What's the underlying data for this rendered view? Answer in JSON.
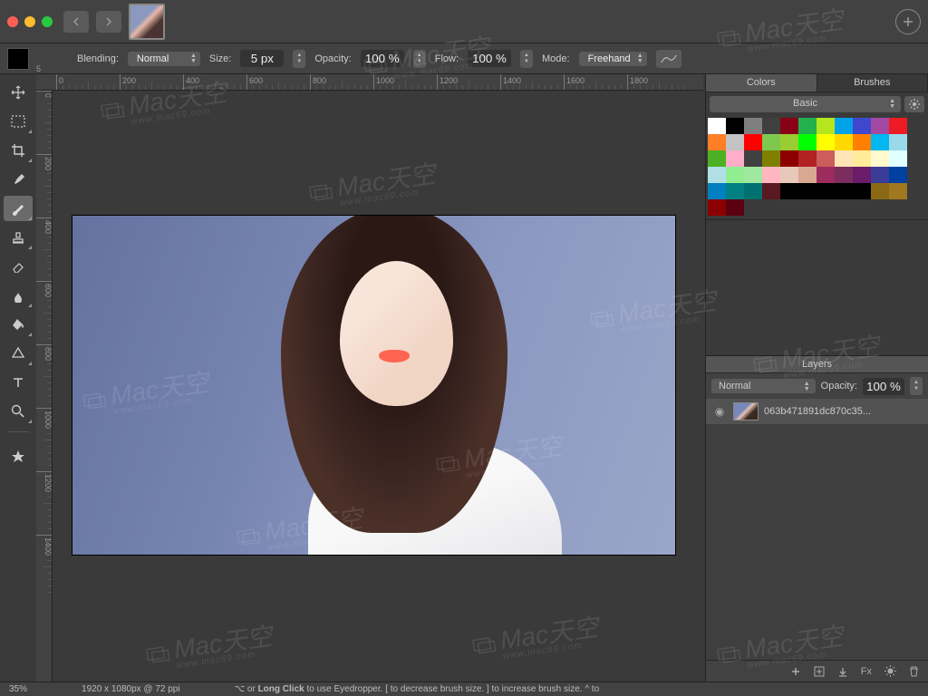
{
  "options": {
    "blending_label": "Blending:",
    "blending_value": "Normal",
    "size_label": "Size:",
    "size_value": "5 px",
    "opacity_label": "Opacity:",
    "opacity_value": "100 %",
    "flow_label": "Flow:",
    "flow_value": "100 %",
    "mode_label": "Mode:",
    "mode_value": "Freehand",
    "brush_size_num": "5"
  },
  "ruler_h": [
    "0",
    "200",
    "400",
    "600",
    "800",
    "1000",
    "1200",
    "1400",
    "1600",
    "1800"
  ],
  "ruler_v": [
    "0",
    "200",
    "400",
    "600",
    "800",
    "1000",
    "1200",
    "1400"
  ],
  "right": {
    "tabs": {
      "colors": "Colors",
      "brushes": "Brushes"
    },
    "palette_preset": "Basic",
    "swatches": [
      "#ffffff",
      "#000000",
      "#7f7f7f",
      "#3f3f3f",
      "#880016",
      "#23b14d",
      "#b5e61d",
      "#00a2e8",
      "#3f48cc",
      "#a349a4",
      "#ed1c24",
      "#ff7f27",
      "#c3c3c3",
      "#ff0000",
      "#7ec850",
      "#9acd32",
      "#00ff00",
      "#ffff00",
      "#ffd800",
      "#ff8000",
      "#00b7ef",
      "#99d9ea",
      "#4cb122",
      "#ffaec9",
      "#404040",
      "#808000",
      "#8b0000",
      "#b22222",
      "#cd5c5c",
      "#ffe4b5",
      "#ffeb99",
      "#fffacd",
      "#e0ffff",
      "#b0e0e6",
      "#90ee90",
      "#a0e8a0",
      "#ffb6c1",
      "#e8c8b8",
      "#d8a890",
      "#9e2b5e",
      "#7b2d5e",
      "#6a1b6a",
      "#3b3b98",
      "#0040a0",
      "#0080c0",
      "#008080",
      "#007070",
      "#5a1820",
      "#000000",
      "#000000",
      "#000000",
      "#000000",
      "#000000",
      "#8b6914",
      "#a07820",
      "#8b0000",
      "#5a0010"
    ],
    "layers_title": "Layers",
    "layers_blend": "Normal",
    "layers_opacity_label": "Opacity:",
    "layers_opacity_value": "100 %",
    "layer_name": "063b471891dc870c35..."
  },
  "status": {
    "zoom": "35%",
    "dims": "1920 x 1080px @ 72 ppi",
    "hint_pre": "⌥ or",
    "hint_bold": "Long Click",
    "hint_post": "to use Eyedropper.  [ to decrease brush size.  ] to increase brush size.  ^ to"
  },
  "layer_footer_fx": "Fx",
  "watermark": {
    "brand": "Mac天空",
    "url": "www.mac69.com"
  }
}
